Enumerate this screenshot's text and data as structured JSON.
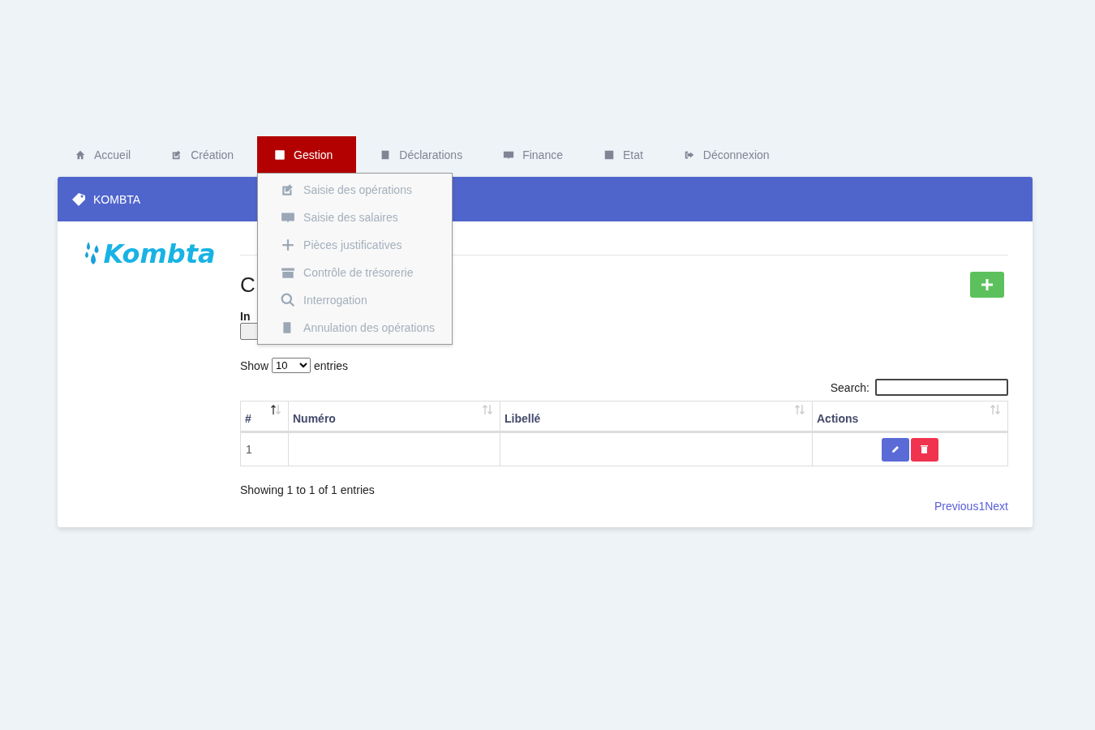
{
  "nav": [
    {
      "label": "Accueil",
      "selected": false
    },
    {
      "label": "Création",
      "selected": false
    },
    {
      "label": "Gestion",
      "selected": true
    },
    {
      "label": "Déclarations",
      "selected": false
    },
    {
      "label": "Finance",
      "selected": false
    },
    {
      "label": "Etat",
      "selected": false
    },
    {
      "label": "Déconnexion",
      "selected": false
    }
  ],
  "dropdown": {
    "open": true,
    "items": [
      "Saisie des opérations",
      "Saisie des salaires",
      "Pièces justificatives",
      "Contrôle de trésorerie",
      "Interrogation",
      "Annulation des opérations"
    ]
  },
  "card": {
    "title": "KOMBTA",
    "logo": "Kombta"
  },
  "heading": "C",
  "import": {
    "label": "In"
  },
  "length": {
    "before": "Show",
    "value": "10",
    "after": "entries"
  },
  "search": {
    "label": "Search:"
  },
  "table": {
    "columns": [
      {
        "label": "#",
        "sorted": true
      },
      {
        "label": "Numéro",
        "sorted": false
      },
      {
        "label": "Libellé",
        "sorted": false
      },
      {
        "label": "Actions",
        "sorted": false
      }
    ],
    "rows": [
      {
        "cells": [
          "1",
          "",
          ""
        ]
      }
    ]
  },
  "info": "Showing 1 to 1 of 1 entries",
  "pagination": [
    "Previous",
    "1",
    "Next"
  ]
}
